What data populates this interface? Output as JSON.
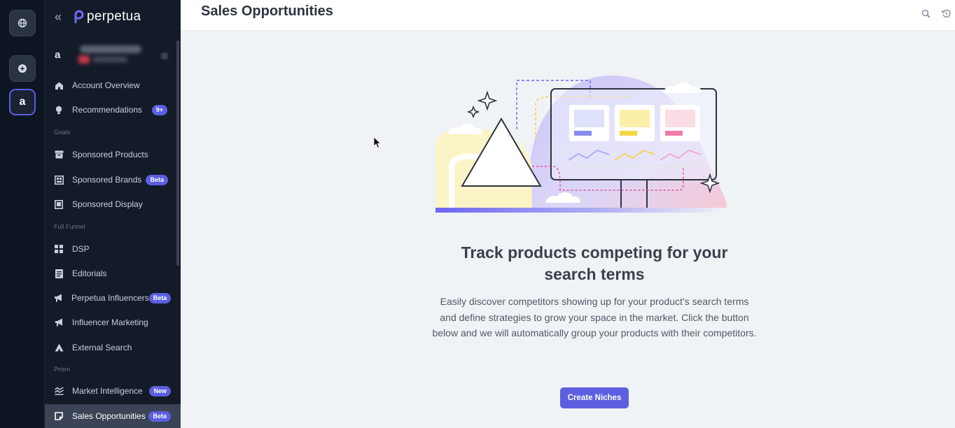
{
  "app": {
    "logo_text": "perpetua"
  },
  "rail": {
    "items": [
      {
        "name": "globe-icon"
      },
      {
        "name": "add-icon"
      },
      {
        "name": "amazon-icon",
        "glyph": "a"
      }
    ]
  },
  "sidebar": {
    "account_glyph": "a",
    "items": [
      {
        "label": "Account Overview",
        "icon": "home-icon"
      },
      {
        "label": "Recommendations",
        "icon": "lightbulb-icon",
        "badge": "9+"
      },
      {
        "label": "Sponsored Products",
        "icon": "box-icon"
      },
      {
        "label": "Sponsored Brands",
        "icon": "brand-icon",
        "badge": "Beta"
      },
      {
        "label": "Sponsored Display",
        "icon": "display-icon"
      },
      {
        "label": "DSP",
        "icon": "grid-icon"
      },
      {
        "label": "Editorials",
        "icon": "document-icon"
      },
      {
        "label": "Perpetua Influencers",
        "icon": "megaphone-icon",
        "badge": "Beta"
      },
      {
        "label": "Influencer Marketing",
        "icon": "megaphone-icon"
      },
      {
        "label": "External Search",
        "icon": "triangle-icon"
      },
      {
        "label": "Market Intelligence",
        "icon": "trend-icon",
        "badge": "New"
      },
      {
        "label": "Sales Opportunities",
        "icon": "note-icon",
        "badge": "Beta"
      }
    ],
    "sections": [
      "Goals",
      "Full Funnel",
      "Prism"
    ]
  },
  "header": {
    "title": "Sales Opportunities"
  },
  "empty_state": {
    "headline": "Track products competing for your search terms",
    "description": "Easily discover competitors showing up for your product's search terms and define strategies to grow your space in the market. Click the button below and we will automatically group your products with their competitors.",
    "cta_label": "Create Niches"
  },
  "colors": {
    "accent": "#5b5fe0",
    "sidebar_bg": "#131b29",
    "rail_bg": "#0d1422"
  }
}
